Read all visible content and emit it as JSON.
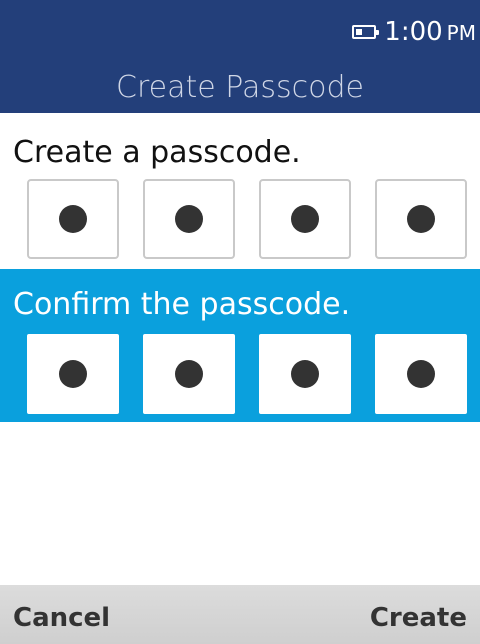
{
  "header": {
    "title": "Create Passcode",
    "status": {
      "battery_icon": "battery-icon",
      "battery_level": 0.35,
      "time": "1:00",
      "ampm": "PM"
    },
    "background_color": "#233f7a"
  },
  "create_section": {
    "label": "Create a passcode.",
    "digits_entered": 4,
    "digit_count": 4
  },
  "confirm_section": {
    "label": "Confirm the passcode.",
    "digits_entered": 4,
    "digit_count": 4,
    "highlight_color": "#0aa0dd"
  },
  "softkeys": {
    "left": "Cancel",
    "right": "Create"
  }
}
